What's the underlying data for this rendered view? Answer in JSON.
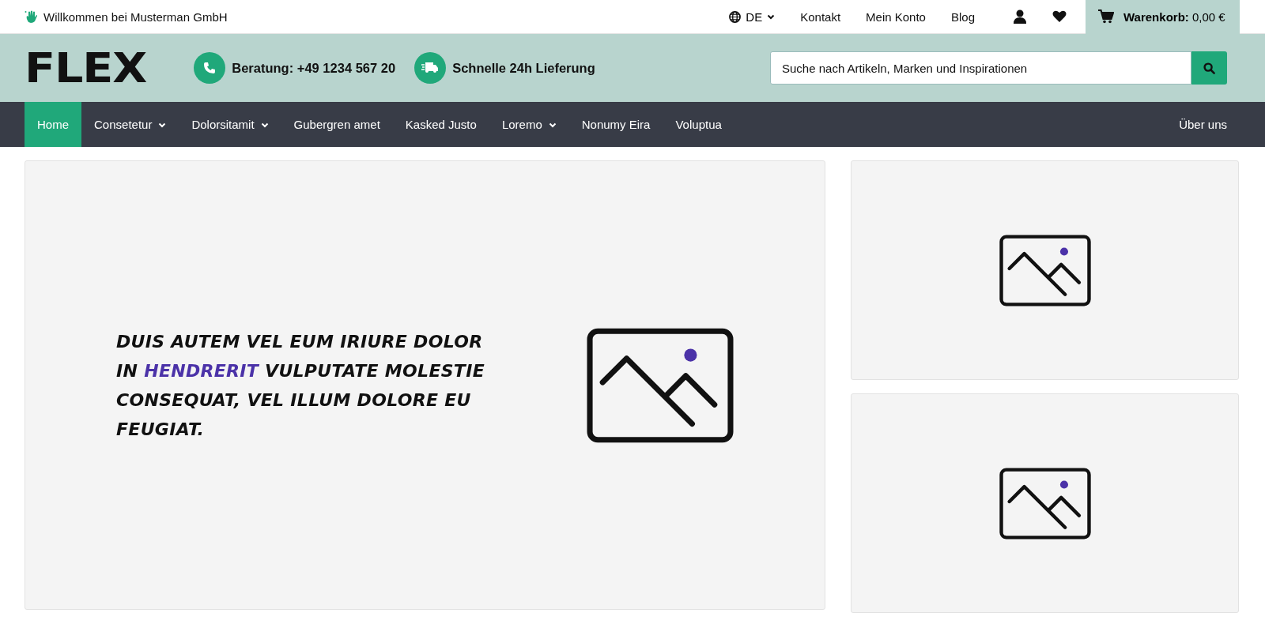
{
  "top_bar": {
    "welcome": "Willkommen bei Musterman GmbH",
    "language": "DE",
    "links": [
      "Kontakt",
      "Mein Konto",
      "Blog"
    ],
    "cart": "**Warenkorb:** 0,00 €"
  },
  "header": {
    "logo": "FLEX",
    "features": [
      {
        "kind": "phone",
        "text": "Beratung: +49 1234 567 20"
      },
      {
        "kind": "truck",
        "text": "Schnelle 24h Lieferung"
      }
    ],
    "search": {
      "placeholder": "Suche nach Artikeln, Marken und Inspirationen"
    }
  },
  "nav": {
    "items": [
      {
        "label": "Home",
        "selected": true,
        "dropdown": false
      },
      {
        "label": "Consetetur",
        "selected": false,
        "dropdown": true
      },
      {
        "label": "Dolorsitamit",
        "selected": false,
        "dropdown": true
      },
      {
        "label": "Gubergren amet",
        "selected": false,
        "dropdown": false
      },
      {
        "label": "Kasked Justo",
        "selected": false,
        "dropdown": false
      },
      {
        "label": "Loremo",
        "selected": false,
        "dropdown": true
      },
      {
        "label": "Nonumy Eira",
        "selected": false,
        "dropdown": false
      },
      {
        "label": "Voluptua",
        "selected": false,
        "dropdown": false
      }
    ],
    "right": "Über uns"
  },
  "hero": {
    "headline": [
      {
        "text": "DUIS AUTEM VEL EUM IRIURE DOLOR IN ",
        "highlight": false
      },
      {
        "text": "HENDRERIT",
        "highlight": true
      },
      {
        "text": " VULPUTATE MOLESTIE CONSEQUAT, VEL ILLUM DOLORE EU FEUGIAT.",
        "highlight": false
      }
    ]
  }
}
